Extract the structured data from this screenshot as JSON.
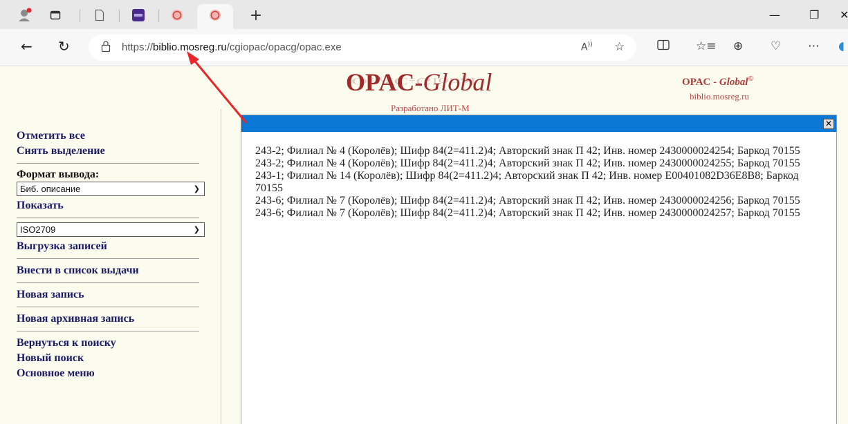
{
  "browser": {
    "url_prefix": "https://",
    "url_host": "biblio.mosreg.ru",
    "url_path": "/cgiopac/opacg/opac.exe"
  },
  "header": {
    "logo_main": "OPAC-",
    "logo_italic": "Global",
    "logo_sub": "Разработано ЛИТ-М",
    "logo_right_prefix": "OPAC - ",
    "logo_right_italic": "Global",
    "logo_right_sup": "©",
    "logo_url": "biblio.mosreg.ru"
  },
  "sidebar": {
    "select_all": "Отметить все",
    "deselect": "Снять выделение",
    "format_label": "Формат вывода:",
    "format_value": "Биб. описание",
    "show": "Показать",
    "export_format": "ISO2709",
    "export": "Выгрузка записей",
    "add_to_list": "Внести в список выдачи",
    "new_record": "Новая запись",
    "new_archive": "Новая архивная запись",
    "back_to_search": "Вернуться к поиску",
    "new_search": "Новый поиск",
    "main_menu": "Основное меню"
  },
  "popup": {
    "close": "✕",
    "records": [
      "243-2; Филиал № 4 (Королёв); Шифр 84(2=411.2)4; Авторский знак П 42; Инв. номер 2430000024254; Баркод 70155",
      "243-2; Филиал № 4 (Королёв); Шифр 84(2=411.2)4; Авторский знак П 42; Инв. номер 2430000024255; Баркод 70155",
      "243-1; Филиал № 14 (Королёв); Шифр 84(2=411.2)4; Авторский знак П 42; Инв. номер E00401082D36E8B8; Баркод 70155",
      "243-6; Филиал № 7 (Королёв); Шифр 84(2=411.2)4; Авторский знак П 42; Инв. номер 2430000024256; Баркод 70155",
      "243-6; Филиал № 7 (Королёв); Шифр 84(2=411.2)4; Авторский знак П 42; Инв. номер 2430000024257; Баркод 70155"
    ]
  },
  "colors": {
    "accent_bar": "#0a78d4",
    "annotation_arrow": "#e8262a"
  }
}
